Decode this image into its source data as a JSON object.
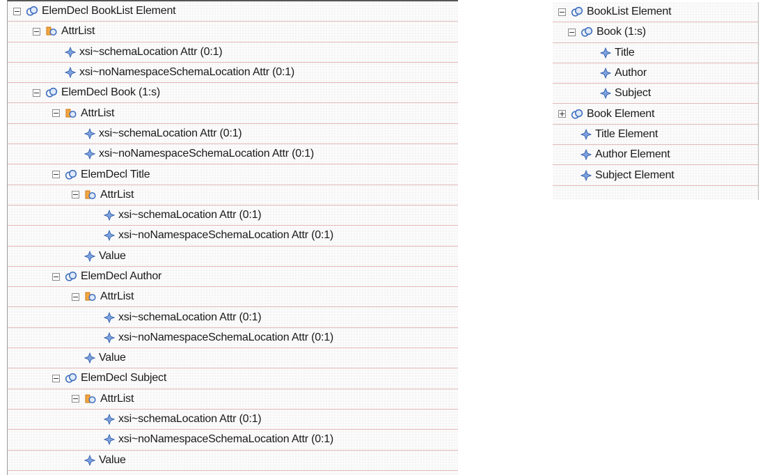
{
  "left_tree": {
    "rows": [
      {
        "label": "ElemDecl BookList Element",
        "icon": "element-decl-icon",
        "toggle": "minus",
        "depth": 0
      },
      {
        "label": "AttrList",
        "icon": "attr-list-icon",
        "toggle": "minus",
        "depth": 1
      },
      {
        "label": "xsi~schemaLocation Attr (0:1)",
        "icon": "attribute-icon",
        "toggle": "none",
        "depth": 2
      },
      {
        "label": "xsi~noNamespaceSchemaLocation Attr (0:1)",
        "icon": "attribute-icon",
        "toggle": "none",
        "depth": 2
      },
      {
        "label": "ElemDecl Book (1:s)",
        "icon": "element-decl-icon",
        "toggle": "minus",
        "depth": 1
      },
      {
        "label": "AttrList",
        "icon": "attr-list-icon",
        "toggle": "minus",
        "depth": 2
      },
      {
        "label": "xsi~schemaLocation Attr (0:1)",
        "icon": "attribute-icon",
        "toggle": "none",
        "depth": 3
      },
      {
        "label": "xsi~noNamespaceSchemaLocation Attr (0:1)",
        "icon": "attribute-icon",
        "toggle": "none",
        "depth": 3
      },
      {
        "label": "ElemDecl Title",
        "icon": "element-decl-icon",
        "toggle": "minus",
        "depth": 2
      },
      {
        "label": "AttrList",
        "icon": "attr-list-icon",
        "toggle": "minus",
        "depth": 3
      },
      {
        "label": "xsi~schemaLocation Attr (0:1)",
        "icon": "attribute-icon",
        "toggle": "none",
        "depth": 4
      },
      {
        "label": "xsi~noNamespaceSchemaLocation Attr (0:1)",
        "icon": "attribute-icon",
        "toggle": "none",
        "depth": 4
      },
      {
        "label": "Value",
        "icon": "attribute-icon",
        "toggle": "none",
        "depth": 3
      },
      {
        "label": "ElemDecl Author",
        "icon": "element-decl-icon",
        "toggle": "minus",
        "depth": 2
      },
      {
        "label": "AttrList",
        "icon": "attr-list-icon",
        "toggle": "minus",
        "depth": 3
      },
      {
        "label": "xsi~schemaLocation Attr (0:1)",
        "icon": "attribute-icon",
        "toggle": "none",
        "depth": 4
      },
      {
        "label": "xsi~noNamespaceSchemaLocation Attr (0:1)",
        "icon": "attribute-icon",
        "toggle": "none",
        "depth": 4
      },
      {
        "label": "Value",
        "icon": "attribute-icon",
        "toggle": "none",
        "depth": 3
      },
      {
        "label": "ElemDecl Subject",
        "icon": "element-decl-icon",
        "toggle": "minus",
        "depth": 2
      },
      {
        "label": "AttrList",
        "icon": "attr-list-icon",
        "toggle": "minus",
        "depth": 3
      },
      {
        "label": "xsi~schemaLocation Attr (0:1)",
        "icon": "attribute-icon",
        "toggle": "none",
        "depth": 4
      },
      {
        "label": "xsi~noNamespaceSchemaLocation Attr (0:1)",
        "icon": "attribute-icon",
        "toggle": "none",
        "depth": 4
      },
      {
        "label": "Value",
        "icon": "attribute-icon",
        "toggle": "none",
        "depth": 3
      }
    ]
  },
  "right_tree": {
    "rows": [
      {
        "label": "BookList Element",
        "icon": "element-decl-icon",
        "toggle": "minus",
        "depth": 0
      },
      {
        "label": "Book (1:s)",
        "icon": "element-decl-icon",
        "toggle": "minus",
        "depth": 1
      },
      {
        "label": "Title",
        "icon": "attribute-icon",
        "toggle": "none",
        "depth": 3
      },
      {
        "label": "Author",
        "icon": "attribute-icon",
        "toggle": "none",
        "depth": 3
      },
      {
        "label": "Subject",
        "icon": "attribute-icon",
        "toggle": "none",
        "depth": 3
      },
      {
        "label": "Book Element",
        "icon": "element-decl-icon",
        "toggle": "plus",
        "depth": 0
      },
      {
        "label": "Title Element",
        "icon": "attribute-icon",
        "toggle": "none",
        "depth": 1
      },
      {
        "label": "Author Element",
        "icon": "attribute-icon",
        "toggle": "none",
        "depth": 1
      },
      {
        "label": "Subject Element",
        "icon": "attribute-icon",
        "toggle": "none",
        "depth": 1
      }
    ]
  },
  "colors": {
    "row_separator": "#e3b8b8",
    "icon_blue": "#3f6fbe",
    "icon_orange": "#e08a1e"
  }
}
